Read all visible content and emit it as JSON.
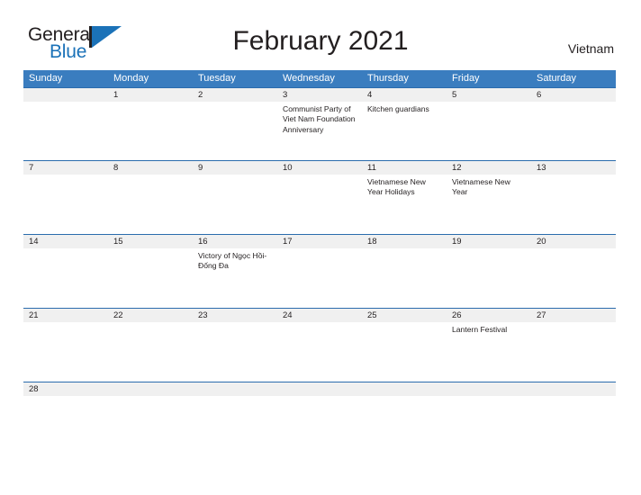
{
  "header": {
    "logo": {
      "word1": "General",
      "word2": "Blue",
      "mark": "blue-triangle-flag"
    },
    "title": "February 2021",
    "country": "Vietnam"
  },
  "colors": {
    "header_blue": "#3a7dbf",
    "row_rule_blue": "#2b6cad",
    "date_band_gray": "#f0f0f0",
    "logo_blue": "#1b72b8",
    "text": "#231f20"
  },
  "calendar": {
    "weekdays": [
      "Sunday",
      "Monday",
      "Tuesday",
      "Wednesday",
      "Thursday",
      "Friday",
      "Saturday"
    ],
    "weeks": [
      {
        "days": [
          {
            "date": "",
            "events": []
          },
          {
            "date": "1",
            "events": []
          },
          {
            "date": "2",
            "events": []
          },
          {
            "date": "3",
            "events": [
              "Communist Party of Viet Nam Foundation Anniversary"
            ]
          },
          {
            "date": "4",
            "events": [
              "Kitchen guardians"
            ]
          },
          {
            "date": "5",
            "events": []
          },
          {
            "date": "6",
            "events": []
          }
        ]
      },
      {
        "days": [
          {
            "date": "7",
            "events": []
          },
          {
            "date": "8",
            "events": []
          },
          {
            "date": "9",
            "events": []
          },
          {
            "date": "10",
            "events": []
          },
          {
            "date": "11",
            "events": [
              "Vietnamese New Year Holidays"
            ]
          },
          {
            "date": "12",
            "events": [
              "Vietnamese New Year"
            ]
          },
          {
            "date": "13",
            "events": []
          }
        ]
      },
      {
        "days": [
          {
            "date": "14",
            "events": []
          },
          {
            "date": "15",
            "events": []
          },
          {
            "date": "16",
            "events": [
              "Victory of Ngọc Hồi-Đống Đa"
            ]
          },
          {
            "date": "17",
            "events": []
          },
          {
            "date": "18",
            "events": []
          },
          {
            "date": "19",
            "events": []
          },
          {
            "date": "20",
            "events": []
          }
        ]
      },
      {
        "days": [
          {
            "date": "21",
            "events": []
          },
          {
            "date": "22",
            "events": []
          },
          {
            "date": "23",
            "events": []
          },
          {
            "date": "24",
            "events": []
          },
          {
            "date": "25",
            "events": []
          },
          {
            "date": "26",
            "events": [
              "Lantern Festival"
            ]
          },
          {
            "date": "27",
            "events": []
          }
        ]
      },
      {
        "days": [
          {
            "date": "28",
            "events": []
          },
          {
            "date": "",
            "events": []
          },
          {
            "date": "",
            "events": []
          },
          {
            "date": "",
            "events": []
          },
          {
            "date": "",
            "events": []
          },
          {
            "date": "",
            "events": []
          },
          {
            "date": "",
            "events": []
          }
        ]
      }
    ]
  }
}
